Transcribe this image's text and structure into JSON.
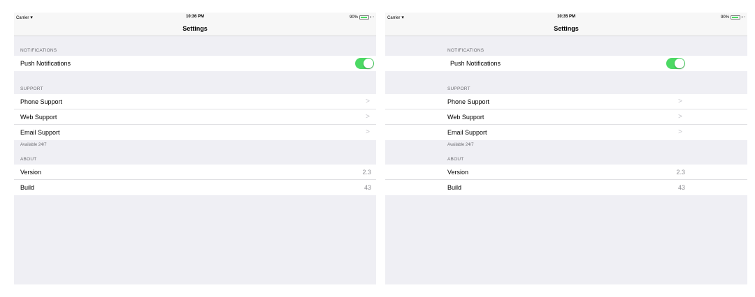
{
  "screens": [
    {
      "status": {
        "carrier": "Carrier",
        "wifi_icon": "wifi-icon",
        "time": "10:36 PM",
        "battery_percent": "90%",
        "battery_level": 0.9
      },
      "title": "Settings",
      "notifications": {
        "header": "NOTIFICATIONS",
        "push_label": "Push Notifications",
        "push_enabled": true
      },
      "support": {
        "header": "SUPPORT",
        "phone": "Phone Support",
        "web": "Web Support",
        "email": "Email Support",
        "footer": "Available 24/7",
        "chevron": ">"
      },
      "about": {
        "header": "ABOUT",
        "version_label": "Version",
        "version_value": "2.3",
        "build_label": "Build",
        "build_value": "43"
      }
    },
    {
      "status": {
        "carrier": "Carrier",
        "wifi_icon": "wifi-icon",
        "time": "10:35 PM",
        "battery_percent": "90%",
        "battery_level": 0.9
      },
      "title": "Settings",
      "notifications": {
        "header": "NOTIFICATIONS",
        "push_label": "Push Notifications",
        "push_enabled": true
      },
      "support": {
        "header": "SUPPORT",
        "phone": "Phone Support",
        "web": "Web Support",
        "email": "Email Support",
        "footer": "Available 24/7",
        "chevron": ">"
      },
      "about": {
        "header": "ABOUT",
        "version_label": "Version",
        "version_value": "2.3",
        "build_label": "Build",
        "build_value": "43"
      }
    }
  ],
  "colors": {
    "toggle_on": "#4cd964",
    "background": "#efeff4",
    "secondary_text": "#6d6d72",
    "chevron": "#c7c7cc"
  }
}
